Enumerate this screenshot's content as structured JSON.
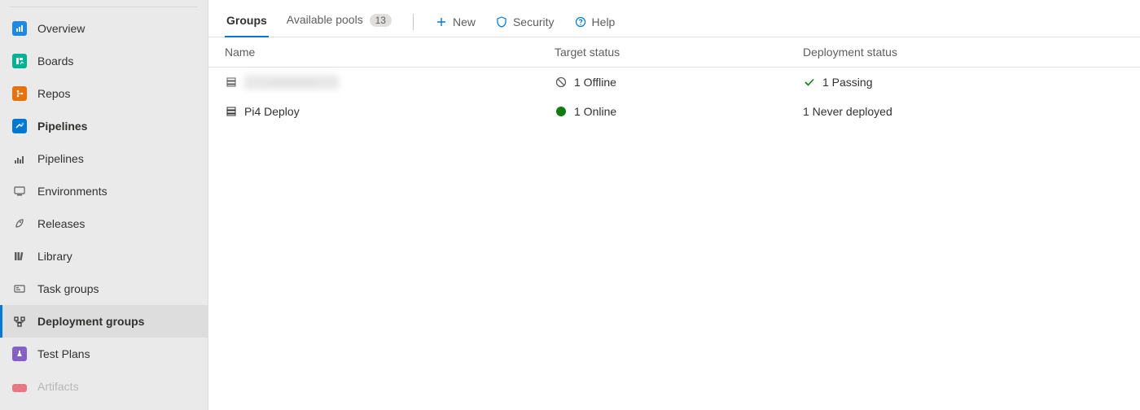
{
  "sidebar": {
    "items": [
      {
        "label": "Overview",
        "icon": "overview"
      },
      {
        "label": "Boards",
        "icon": "boards"
      },
      {
        "label": "Repos",
        "icon": "repos"
      },
      {
        "label": "Pipelines",
        "icon": "pipelines",
        "bold": true
      },
      {
        "label": "Pipelines",
        "icon": "sub-pipelines"
      },
      {
        "label": "Environments",
        "icon": "environments"
      },
      {
        "label": "Releases",
        "icon": "releases"
      },
      {
        "label": "Library",
        "icon": "library"
      },
      {
        "label": "Task groups",
        "icon": "taskgroups"
      },
      {
        "label": "Deployment groups",
        "icon": "deployment-groups",
        "active": true
      },
      {
        "label": "Test Plans",
        "icon": "testplans"
      },
      {
        "label": "Artifacts",
        "icon": "artifacts"
      }
    ]
  },
  "tabs": {
    "groups": "Groups",
    "available_pools": "Available pools",
    "available_pools_badge": "13"
  },
  "actions": {
    "new": "New",
    "security": "Security",
    "help": "Help"
  },
  "table": {
    "headers": {
      "name": "Name",
      "target": "Target status",
      "deploy": "Deployment status"
    },
    "rows": [
      {
        "name_blurred": true,
        "name": "············",
        "target_icon": "offline",
        "target": "1 Offline",
        "deploy_icon": "check",
        "deploy": "1 Passing"
      },
      {
        "name_blurred": false,
        "name": "Pi4 Deploy",
        "target_icon": "online",
        "target": "1 Online",
        "deploy_icon": "",
        "deploy": "1 Never deployed"
      }
    ]
  }
}
